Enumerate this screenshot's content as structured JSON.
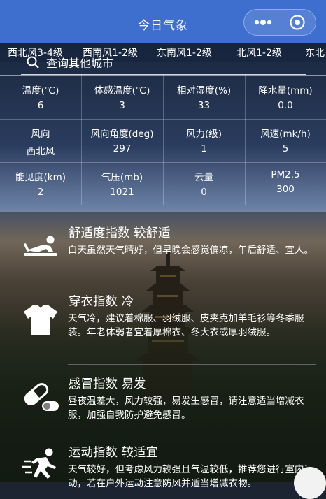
{
  "nav": {
    "title": "今日气象"
  },
  "wind": [
    "西北风3-4级",
    "西南风1-2级",
    "东南风1-2级",
    "北风1-2级",
    "东北"
  ],
  "search": {
    "placeholder": "查询其他城市"
  },
  "grid": [
    {
      "label": "温度(℃)",
      "value": "6"
    },
    {
      "label": "体感温度(℃)",
      "value": "3"
    },
    {
      "label": "相对湿度(%)",
      "value": "33"
    },
    {
      "label": "降水量(mm)",
      "value": "0.0"
    },
    {
      "label": "风向",
      "value": "西北风"
    },
    {
      "label": "风向角度(deg)",
      "value": "297"
    },
    {
      "label": "风力(级)",
      "value": "1"
    },
    {
      "label": "风速(mk/h)",
      "value": "5"
    },
    {
      "label": "能见度(km)",
      "value": "2"
    },
    {
      "label": "气压(mb)",
      "value": "1021"
    },
    {
      "label": "云量",
      "value": "0"
    },
    {
      "label": "PM2.5",
      "value": "300"
    }
  ],
  "indices": [
    {
      "title": "舒适度指数 较舒适",
      "desc": "白天虽然天气晴好，但早晚会感觉偏凉，午后舒适、宜人。",
      "icon": "lying-person-icon"
    },
    {
      "title": "穿衣指数 冷",
      "desc": "天气冷，建议着棉服、羽绒服、皮夹克加羊毛衫等冬季服装。年老体弱者宜着厚棉衣、冬大衣或厚羽绒服。",
      "icon": "tshirt-icon"
    },
    {
      "title": "感冒指数 易发",
      "desc": "昼夜温差大，风力较强，易发生感冒，请注意适当增减衣服，加强自我防护避免感冒。",
      "icon": "pill-icon"
    },
    {
      "title": "运动指数 较适宜",
      "desc": "天气较好，但考虑风力较强且气温较低，推荐您进行室内运动，若在户外运动注意防风并适当增减衣物。",
      "icon": "running-person-icon"
    }
  ]
}
